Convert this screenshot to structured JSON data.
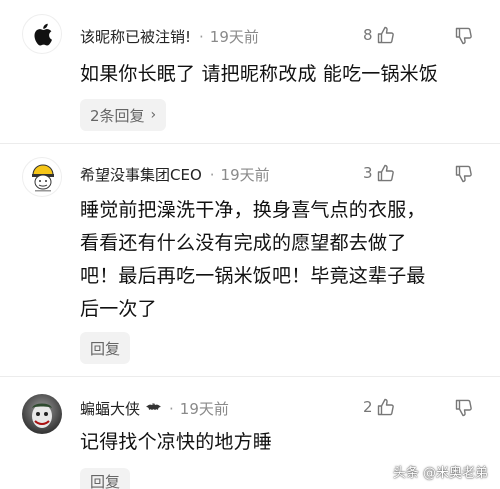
{
  "comments": [
    {
      "username": "该昵称已被注销!",
      "time": "19天前",
      "likes": "8",
      "text": "如果你长眠了 请把昵称改成 能吃一锅米饭",
      "reply_label": "2条回复"
    },
    {
      "username": "希望没事集团CEO",
      "time": "19天前",
      "likes": "3",
      "text": "睡觉前把澡洗干净，换身喜气点的衣服，\n看看还有什么没有完成的愿望都去做了\n吧！最后再吃一锅米饭吧！毕竟这辈子最\n后一次了",
      "reply_label": "回复"
    },
    {
      "username": "蝙蝠大侠",
      "time": "19天前",
      "likes": "2",
      "text": "记得找个凉快的地方睡",
      "reply_label": "回复"
    }
  ],
  "watermark": "头条 @米奥老弟",
  "icons": {
    "like": "thumbs-up-icon",
    "dislike": "thumbs-down-icon",
    "chevron": "chevron-right-icon",
    "badge": "bat-icon"
  }
}
